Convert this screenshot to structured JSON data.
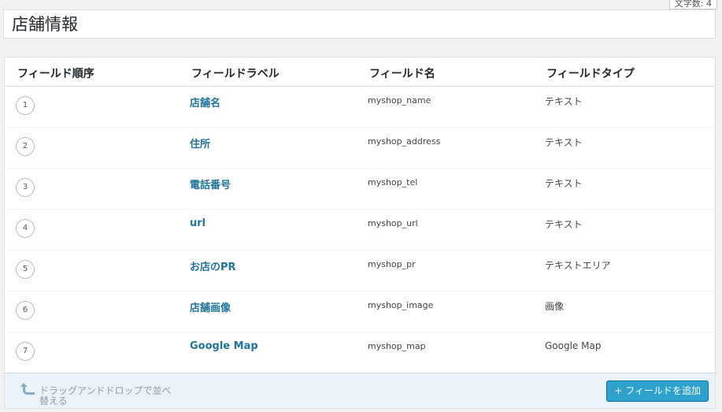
{
  "wordcount": {
    "label": "文字数: 4"
  },
  "field_group": {
    "title": "店舗情報"
  },
  "table": {
    "headers": {
      "order": "フィールド順序",
      "label": "フィールドラベル",
      "name": "フィールド名",
      "type": "フィールドタイプ"
    },
    "rows": [
      {
        "order": "1",
        "label": "店舗名",
        "name": "myshop_name",
        "type": "テキスト"
      },
      {
        "order": "2",
        "label": "住所",
        "name": "myshop_address",
        "type": "テキスト"
      },
      {
        "order": "3",
        "label": "電話番号",
        "name": "myshop_tel",
        "type": "テキスト"
      },
      {
        "order": "4",
        "label": "url",
        "name": "myshop_url",
        "type": "テキスト"
      },
      {
        "order": "5",
        "label": "お店のPR",
        "name": "myshop_pr",
        "type": "テキストエリア"
      },
      {
        "order": "6",
        "label": "店舗画像",
        "name": "myshop_image",
        "type": "画像"
      },
      {
        "order": "7",
        "label": "Google Map",
        "name": "myshop_map",
        "type": "Google Map"
      }
    ]
  },
  "footer": {
    "drag_hint": "ドラッグアンドドロップで並べ替える",
    "add_button": "+ フィールドを追加",
    "icon": "curved-arrow-up-icon"
  },
  "colors": {
    "link": "#21759b",
    "button": "#2ea2cc",
    "footer_bg": "#eaf2fa"
  }
}
